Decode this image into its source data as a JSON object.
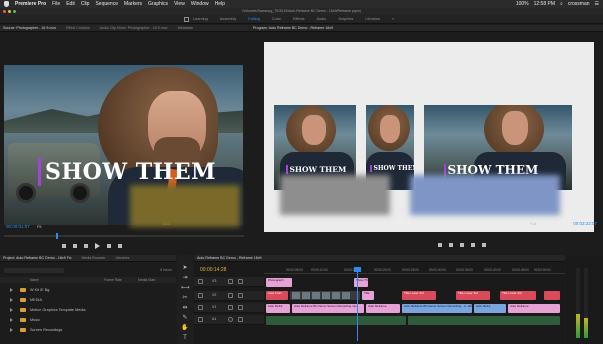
{
  "menubar": {
    "app": "Premiere Pro",
    "items": [
      "File",
      "Edit",
      "Clip",
      "Sequence",
      "Markers",
      "Graphics",
      "View",
      "Window",
      "Help"
    ],
    "clock": "12:58 PM",
    "user": "crossman",
    "battery": "100%"
  },
  "titlebar": {
    "title": "/Volumes/Samsung_T5/2019/Auto Reframe BC Demo - 16x9/Reframe.prproj"
  },
  "workspaces": {
    "items": [
      "Learning",
      "Assembly",
      "Editing",
      "Color",
      "Effects",
      "Audio",
      "Graphics",
      "Libraries"
    ],
    "active": "Editing"
  },
  "source": {
    "tabs": [
      "Source: Photographer - 16 9.mov",
      "Effect Controls",
      "Audio Clip Mixer: Photographer - 16 9.mov",
      "Metadata"
    ],
    "lower_third": "SHOW THEM",
    "timecode": "00:00:01:07",
    "fit": "Fit"
  },
  "program": {
    "tabs": [
      "Program: Auto Reframe BC Demo - Reframe 16x9"
    ],
    "lower_third": "SHOW THEM",
    "fit": "Full",
    "timecode": "00:03:22:07"
  },
  "project": {
    "tabs": [
      "Project: Auto Reframe BC Demo - 16x9 Fix",
      "Media Browser",
      "Libraries"
    ],
    "item_count": "8 Items",
    "columns": [
      "Name",
      "Frame Rate",
      "Media Start"
    ],
    "bins": [
      "W Kit IE Bg",
      "MEDIA",
      "Motion Graphics Template Media",
      "Music",
      "Screen Recordings"
    ]
  },
  "timeline": {
    "tab": "Auto Reframe BC Demo - Reframe 16x9",
    "timecode": "00:00:14:28",
    "ruler": [
      "00:00:05:00",
      "00:00:10:00",
      "00:00:15:00",
      "00:00:20:00",
      "00:00:25:00",
      "00:00:30:00",
      "00:00:35:00",
      "00:00:40:00",
      "00:00:45:00",
      "00:00:50:00",
      "00:00:55:00"
    ],
    "tracks": [
      "V3",
      "V2",
      "V1",
      "A1"
    ],
    "clips": {
      "lower_third": "Photograph",
      "show_them": "Show Them",
      "title": "Title",
      "red_a": "Auto Fram",
      "red_b": "Title Lower 3rd",
      "red_c": "Title Lower 3rd",
      "red_d": "Title Lower 3rd",
      "v1_a": "Auto Refra",
      "v1_b": "Auto Reframe BC Demo Screen Recording.mp4",
      "v1_c": "Auto Reframe BC Demo Screen Recording - 3 - EFFECT Icon",
      "v1_d": "Auto Reframe",
      "v1_e": "Auto Refra",
      "v1_f": "Auto Reframe"
    }
  },
  "meters": {
    "level_left": 0.35,
    "level_right": 0.28
  }
}
